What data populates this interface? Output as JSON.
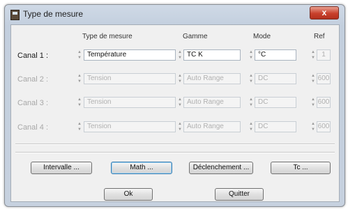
{
  "window": {
    "title": "Type de mesure",
    "close_glyph": "x",
    "title_icon": "measure-app-icon"
  },
  "headers": {
    "type": "Type de mesure",
    "gamme": "Gamme",
    "mode": "Mode",
    "ref": "Ref"
  },
  "channels": [
    {
      "label": "Canal 1 :",
      "type": "Température",
      "gamme": "TC K",
      "mode": "°C",
      "ref": "1",
      "enabled": true
    },
    {
      "label": "Canal 2 :",
      "type": "Tension",
      "gamme": "Auto Range",
      "mode": "DC",
      "ref": "600",
      "enabled": false
    },
    {
      "label": "Canal 3 :",
      "type": "Tension",
      "gamme": "Auto Range",
      "mode": "DC",
      "ref": "600",
      "enabled": false
    },
    {
      "label": "Canal 4 :",
      "type": "Tension",
      "gamme": "Auto Range",
      "mode": "DC",
      "ref": "600",
      "enabled": false
    }
  ],
  "buttons": {
    "intervalle": "Intervalle ...",
    "math": "Math ...",
    "declenchement": "Déclenchement ...",
    "tc": "Tc ...",
    "ok": "Ok",
    "quitter": "Quitter"
  }
}
